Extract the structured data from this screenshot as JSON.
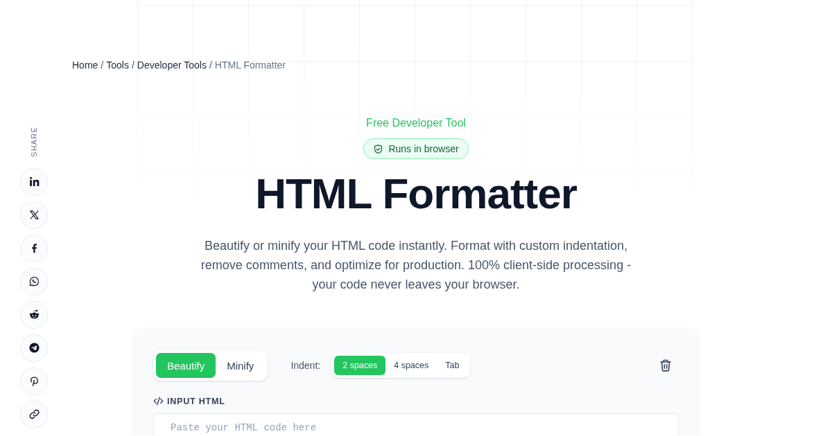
{
  "breadcrumb": [
    {
      "kind": "link",
      "label": "Home"
    },
    {
      "kind": "separator",
      "label": "/"
    },
    {
      "kind": "link",
      "label": "Tools"
    },
    {
      "kind": "separator",
      "label": "/"
    },
    {
      "kind": "link",
      "label": "Developer Tools"
    },
    {
      "kind": "separator",
      "label": "/"
    },
    {
      "kind": "current",
      "label": "HTML Formatter"
    }
  ],
  "share": {
    "label": "SHARE"
  },
  "hero": {
    "eyebrow": "Free Developer Tool",
    "badge": "Runs in browser",
    "title": "HTML Formatter",
    "description": "Beautify or minify your HTML code instantly. Format with custom indentation, remove comments, and optimize for production. 100% client-side processing - your code never leaves your browser."
  },
  "formatter": {
    "modes": [
      {
        "label": "Beautify",
        "selected": true
      },
      {
        "label": "Minify",
        "selected": false
      }
    ],
    "indent_label": "Indent:",
    "indent_options": [
      {
        "label": "2 spaces",
        "selected": true
      },
      {
        "label": "4 spaces",
        "selected": false
      },
      {
        "label": "Tab",
        "selected": false
      }
    ],
    "input_label": "INPUT HTML",
    "input": {
      "placeholder": "Paste your HTML code here"
    }
  }
}
